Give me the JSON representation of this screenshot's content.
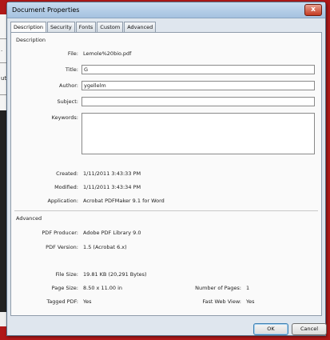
{
  "background_app": {
    "fragments": [
      ".",
      "ut"
    ]
  },
  "window": {
    "title": "Document Properties",
    "close_label": "x"
  },
  "tabs": [
    {
      "label": "Description"
    },
    {
      "label": "Security"
    },
    {
      "label": "Fonts"
    },
    {
      "label": "Custom"
    },
    {
      "label": "Advanced"
    }
  ],
  "description": {
    "section_label": "Description",
    "file_label": "File:",
    "file_value": "Lemole%20bio.pdf",
    "title_label": "Title:",
    "title_value": "G",
    "author_label": "Author:",
    "author_value": "ygellelm",
    "subject_label": "Subject:",
    "subject_value": "",
    "keywords_label": "Keywords:",
    "keywords_value": "",
    "created_label": "Created:",
    "created_value": "1/11/2011 3:43:33 PM",
    "modified_label": "Modified:",
    "modified_value": "1/11/2011 3:43:34 PM",
    "application_label": "Application:",
    "application_value": "Acrobat PDFMaker 9.1 for Word"
  },
  "advanced": {
    "section_label": "Advanced",
    "producer_label": "PDF Producer:",
    "producer_value": "Adobe PDF Library 9.0",
    "version_label": "PDF Version:",
    "version_value": "1.5 (Acrobat 6.x)",
    "filesize_label": "File Size:",
    "filesize_value": "19.81 KB (20,291 Bytes)",
    "pagesize_label": "Page Size:",
    "pagesize_value": "8.50 x 11.00 in",
    "pages_label": "Number of Pages:",
    "pages_value": "1",
    "tagged_label": "Tagged PDF:",
    "tagged_value": "Yes",
    "fastweb_label": "Fast Web View:",
    "fastweb_value": "Yes"
  },
  "buttons": {
    "ok": "OK",
    "cancel": "Cancel"
  },
  "colors": {
    "background_red": "#b01818",
    "titlebar_top": "#c7dbef",
    "close_button": "#c43b22",
    "panel": "#fafafa"
  }
}
